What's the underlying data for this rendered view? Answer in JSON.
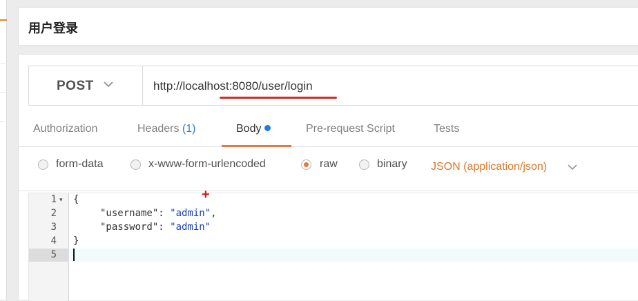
{
  "window": {
    "title": "用户登录"
  },
  "request": {
    "method": "POST",
    "url": "http://localhost:8080/user/login"
  },
  "tabs": [
    {
      "label": "Authorization"
    },
    {
      "label": "Headers",
      "count": "(1)"
    },
    {
      "label": "Body",
      "active": true,
      "indicator": "modified-dot"
    },
    {
      "label": "Pre-request Script"
    },
    {
      "label": "Tests"
    }
  ],
  "body_types": [
    {
      "label": "form-data",
      "checked": false
    },
    {
      "label": "x-www-form-urlencoded",
      "checked": false
    },
    {
      "label": "raw",
      "checked": true
    },
    {
      "label": "binary",
      "checked": false
    }
  ],
  "content_type": {
    "selected": "JSON (application/json)"
  },
  "editor": {
    "line_numbers": [
      "1",
      "2",
      "3",
      "4",
      "5"
    ],
    "active_line": "5",
    "lines": {
      "l1": "{",
      "l2_key": "\"username\"",
      "l2_sep": ": ",
      "l2_val": "\"admin\"",
      "l2_end": ",",
      "l3_key": "\"password\"",
      "l3_sep": ": ",
      "l3_val": "\"admin\"",
      "l4": "}"
    }
  },
  "colors": {
    "accent": "#e8773a",
    "annotation_red": "#d42a2a",
    "link_blue": "#2a7fd4",
    "string_blue": "#1a3fbf"
  }
}
